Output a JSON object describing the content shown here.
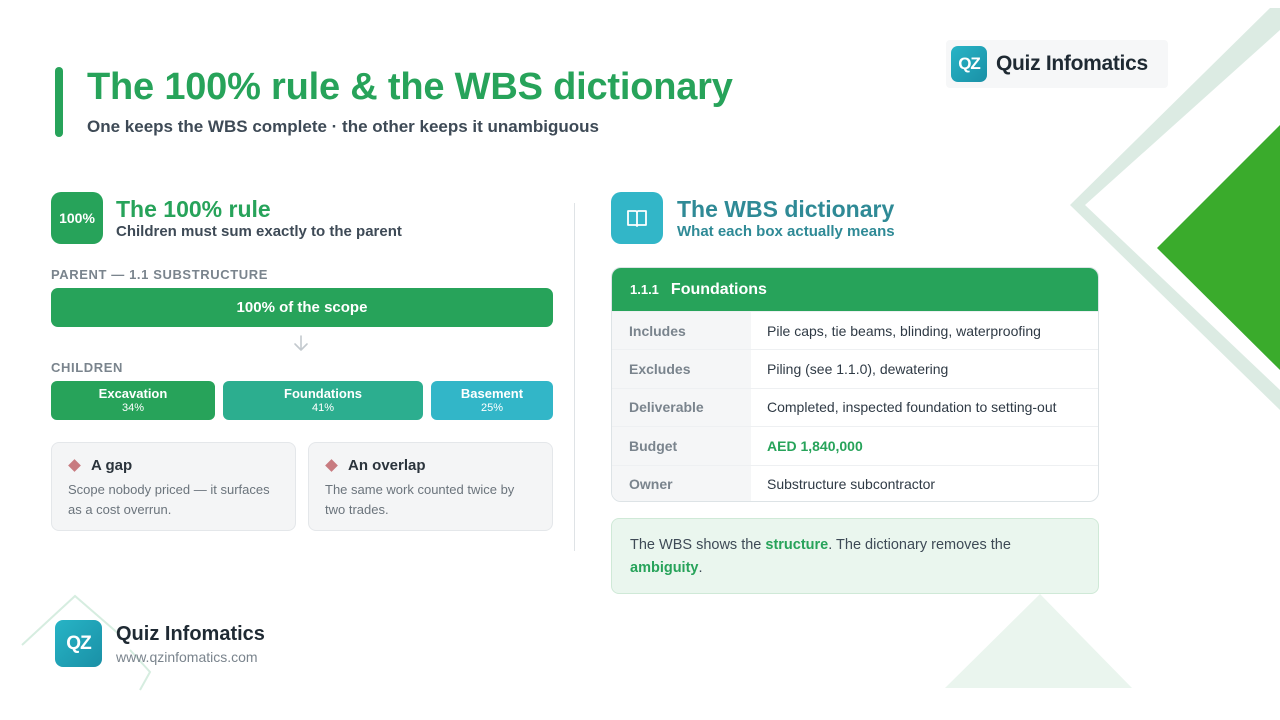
{
  "header": {
    "title": "The 100% rule & the WBS dictionary",
    "subtitle": "One keeps the WBS complete · the other keeps it unambiguous"
  },
  "brand": {
    "logo_text": "QZ",
    "name": "Quiz Infomatics",
    "url": "www.qzinfomatics.com"
  },
  "left": {
    "icon_text": "100%",
    "title": "The 100% rule",
    "subtitle": "Children must sum exactly to the parent",
    "parent_label": "PARENT — 1.1 SUBSTRUCTURE",
    "parent_bar": "100% of the scope",
    "children_label": "CHILDREN",
    "children": [
      {
        "name": "Excavation",
        "pct": "34%",
        "share": 34,
        "color": "#27a35a"
      },
      {
        "name": "Foundations",
        "pct": "41%",
        "share": 41,
        "color": "#2cae8f"
      },
      {
        "name": "Basement",
        "pct": "25%",
        "share": 25,
        "color": "#32b6c8"
      }
    ],
    "cards": [
      {
        "title": "A gap",
        "body": "Scope nobody priced — it surfaces as a cost overrun."
      },
      {
        "title": "An overlap",
        "body": "The same work counted twice by two trades."
      }
    ]
  },
  "right": {
    "icon": "book-icon",
    "title": "The WBS dictionary",
    "subtitle": "What each box actually means",
    "entry": {
      "code": "1.1.1",
      "name": "Foundations",
      "rows": [
        {
          "key": "Includes",
          "value": "Pile caps, tie beams, blinding, waterproofing"
        },
        {
          "key": "Excludes",
          "value": "Piling (see 1.1.0), dewatering"
        },
        {
          "key": "Deliverable",
          "value": "Completed, inspected foundation to setting-out"
        },
        {
          "key": "Budget",
          "value": "AED 1,840,000"
        },
        {
          "key": "Owner",
          "value": "Substructure subcontractor"
        }
      ]
    },
    "note": {
      "part1": "The WBS shows the ",
      "strong1": "structure",
      "part2": ". The dictionary removes the ",
      "strong2": "ambiguity",
      "part3": "."
    }
  },
  "colors": {
    "green": "#27a35a",
    "teal": "#2cae8f",
    "cyan": "#32b6c8",
    "dict_blue": "#2f8a96"
  }
}
